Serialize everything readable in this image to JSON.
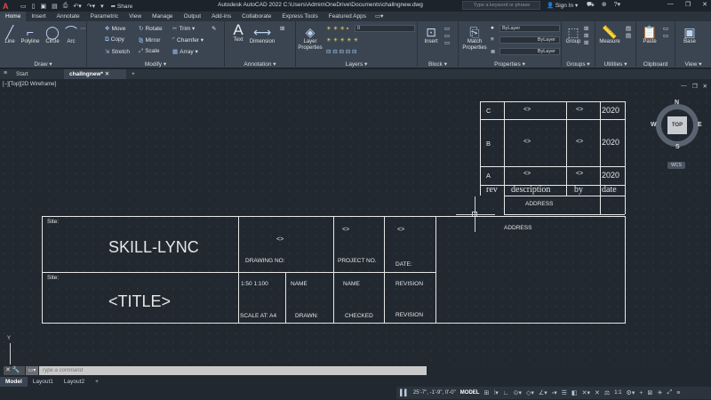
{
  "titlebar": {
    "app_letter": "A",
    "share_label": "Share",
    "title": "Autodesk AutoCAD 2022   C:\\Users\\Admin\\OneDrive\\Documents\\challngnew.dwg",
    "search_placeholder": "Type a keyword or phrase",
    "signin_label": "Sign In"
  },
  "ribbon_tabs": [
    "Home",
    "Insert",
    "Annotate",
    "Parametric",
    "View",
    "Manage",
    "Output",
    "Add-ins",
    "Collaborate",
    "Express Tools",
    "Featured Apps"
  ],
  "ribbon": {
    "draw": {
      "title": "Draw",
      "line": "Line",
      "polyline": "Polyline",
      "circle": "Circle",
      "arc": "Arc"
    },
    "modify": {
      "title": "Modify",
      "move": "Move",
      "rotate": "Rotate",
      "trim": "Trim",
      "copy": "Copy",
      "mirror": "Mirror",
      "chamfer": "Chamfer",
      "stretch": "Stretch",
      "scale": "Scale",
      "array": "Array"
    },
    "annotation": {
      "title": "Annotation",
      "text": "Text",
      "dimension": "Dimension"
    },
    "layers": {
      "title": "Layers",
      "layer_properties": "Layer Properties",
      "current_layer": "0"
    },
    "block": {
      "title": "Block",
      "insert": "Insert"
    },
    "properties": {
      "title": "Properties",
      "match": "Match Properties",
      "color": "ByLayer",
      "linetype": "ByLayer",
      "lineweight": "ByLayer"
    },
    "groups": {
      "title": "Groups",
      "group": "Group"
    },
    "utilities": {
      "title": "Utilities",
      "measure": "Measure"
    },
    "clipboard": {
      "title": "Clipboard",
      "paste": "Paste"
    },
    "view": {
      "title": "View",
      "base": "Base"
    }
  },
  "doc_tabs": {
    "start": "Start",
    "current": "challngnew*",
    "add": "+"
  },
  "viewport_label": "[−][Top][2D Wireframe]",
  "viewcube": {
    "face": "TOP",
    "n": "N",
    "s": "S",
    "e": "E",
    "w": "W",
    "wcs": "WCS"
  },
  "revision_table": {
    "rows": [
      {
        "rev": "C",
        "description": "<>",
        "by": "<>",
        "date": "2020"
      },
      {
        "rev": "B",
        "description": "<>",
        "by": "<>",
        "date": "2020"
      },
      {
        "rev": "A",
        "description": "<>",
        "by": "<>",
        "date": "2020"
      }
    ],
    "header": {
      "rev": "rev",
      "description": "description",
      "by": "by",
      "date": "date"
    },
    "address_inner": "ADDRESS"
  },
  "title_block": {
    "site1": "Site:",
    "company": "SKILL-LYNC",
    "drawing_no_value": "<>",
    "drawing_no_label": "DRAWING NO:",
    "project_no_value": "<>",
    "project_no_label": "PROJECT NO.",
    "date_value": "<>",
    "date_label": "DATE:",
    "address": "ADDRESS",
    "site2": "Site:",
    "title": "<TITLE>",
    "scale_value": "1:50  1:100",
    "drawn_name": "NAME",
    "checked_name": "NAME",
    "revision_top": "REVISION",
    "scale_label": "SCALE AT: A4",
    "drawn_label": "DRAWN:",
    "checked_label": "CHECKED",
    "revision_bottom": "REVISION"
  },
  "ucs": {
    "y_label": "Y"
  },
  "command_line": {
    "placeholder": "Type a command"
  },
  "layout_tabs": [
    "Model",
    "Layout1",
    "Layout2",
    "+"
  ],
  "status": {
    "coords": "25'-7\", -1'-9\", 0'-0\"",
    "mode": "MODEL",
    "annotation_scale": "1:1"
  }
}
